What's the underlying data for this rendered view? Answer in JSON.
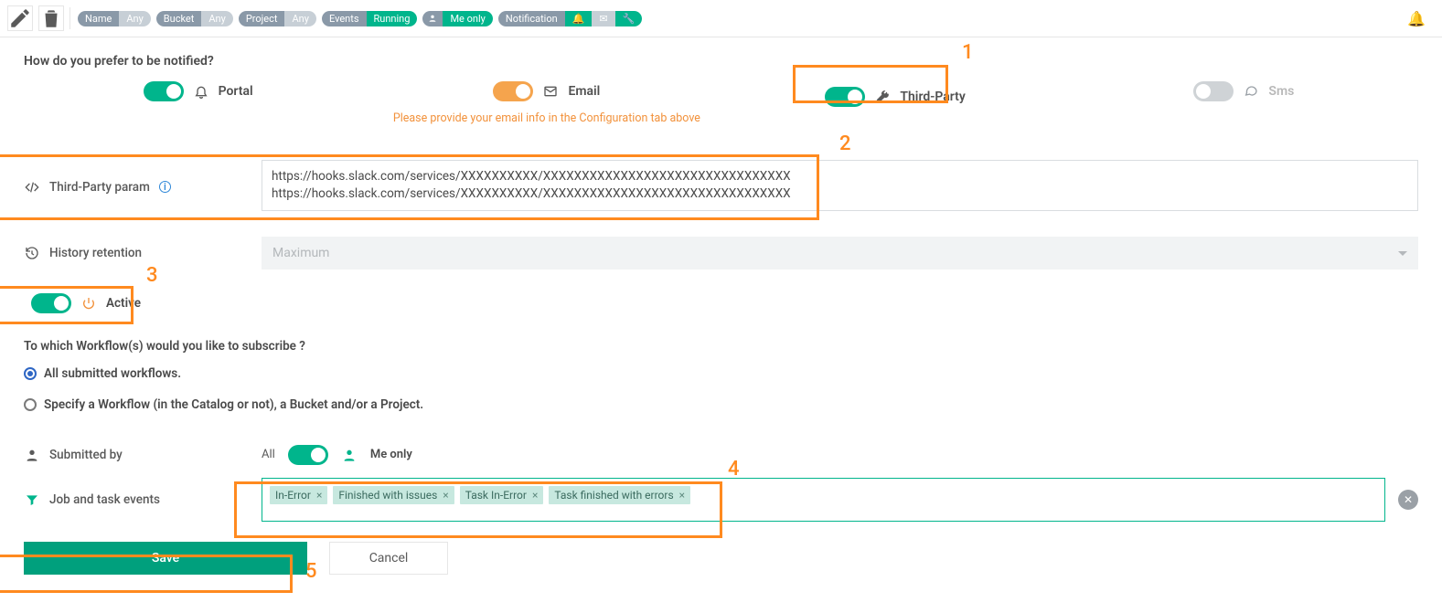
{
  "toolbar": {
    "filters": [
      {
        "label": "Name",
        "value": "Any"
      },
      {
        "label": "Bucket",
        "value": "Any"
      },
      {
        "label": "Project",
        "value": "Any"
      },
      {
        "label": "Events",
        "value": "Running",
        "value_style": "green"
      },
      {
        "label_icon": "user",
        "value": "Me only",
        "value_style": "green"
      },
      {
        "label": "Notification",
        "icons": [
          "bell",
          "mail",
          "wrench"
        ]
      }
    ]
  },
  "question_notify": "How do you prefer to be notified?",
  "channels": {
    "portal": {
      "label": "Portal",
      "on": true
    },
    "email": {
      "label": "Email",
      "on": true,
      "hint": "Please provide your email info in the Configuration tab above"
    },
    "third": {
      "label": "Third-Party",
      "on": true
    },
    "sms": {
      "label": "Sms",
      "on": false
    }
  },
  "third_party_param": {
    "label": "Third-Party param",
    "value": "https://hooks.slack.com/services/XXXXXXXXXX/XXXXXXXXXXXXXXXXXXXXXXXXXXXXXXXX\nhttps://hooks.slack.com/services/XXXXXXXXXX/XXXXXXXXXXXXXXXXXXXXXXXXXXXXXXXX"
  },
  "history": {
    "label": "History retention",
    "value": "Maximum"
  },
  "active": {
    "label": "Active",
    "on": true
  },
  "subscribe_q": "To which Workflow(s) would you like to subscribe ?",
  "subscribe_opts": {
    "all": "All submitted workflows.",
    "specify": "Specify a Workflow (in the Catalog or not), a Bucket and/or a Project."
  },
  "submitted_by": {
    "label": "Submitted by",
    "all": "All",
    "me": "Me only",
    "on": true
  },
  "events": {
    "label": "Job and task events",
    "tags": [
      "In-Error",
      "Finished with issues",
      "Task In-Error",
      "Task finished with errors"
    ]
  },
  "actions": {
    "save": "Save",
    "cancel": "Cancel"
  },
  "callouts": {
    "1": "1",
    "2": "2",
    "3": "3",
    "4": "4",
    "5": "5"
  }
}
